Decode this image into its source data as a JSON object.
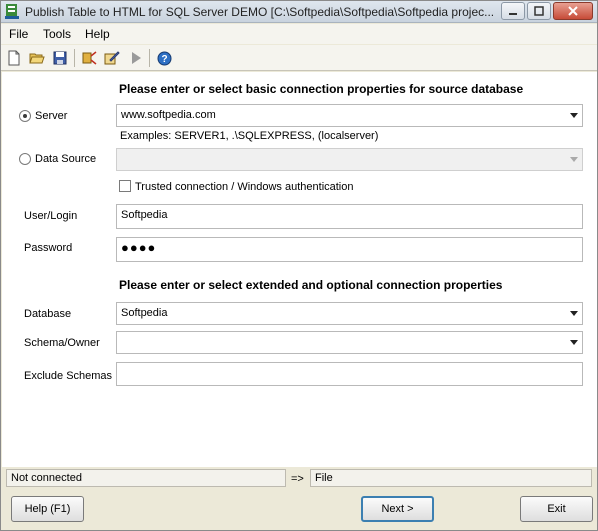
{
  "window": {
    "title": "Publish Table to HTML for SQL Server DEMO [C:\\Softpedia\\Softpedia\\Softpedia projec..."
  },
  "menu": {
    "file": "File",
    "tools": "Tools",
    "help": "Help"
  },
  "toolbar": {
    "icons": [
      "new-icon",
      "open-icon",
      "save-icon",
      "connect-icon",
      "edit-icon",
      "run-icon",
      "help-icon"
    ]
  },
  "source": {
    "heading": "Please enter or select basic connection properties for source database",
    "server_label": "Server",
    "server_value": "www.softpedia.com",
    "server_examples": "Examples: SERVER1, .\\SQLEXPRESS, (localserver)",
    "datasource_label": "Data Source",
    "datasource_value": "",
    "trusted_label": "Trusted connection / Windows authentication",
    "user_label": "User/Login",
    "user_value": "Softpedia",
    "password_label": "Password",
    "password_value": "●●●●"
  },
  "extended": {
    "heading": "Please enter or select extended and optional connection properties",
    "database_label": "Database",
    "database_value": "Softpedia",
    "schema_label": "Schema/Owner",
    "schema_value": "",
    "exclude_label": "Exclude Schemas",
    "exclude_value": ""
  },
  "status": {
    "left": "Not connected",
    "arrow": "=>",
    "right": "File"
  },
  "buttons": {
    "help": "Help (F1)",
    "next": "Next >",
    "exit": "Exit"
  },
  "colors": {
    "window_bg": "#ece9d8",
    "content_bg": "#ffffff",
    "accent_border": "#3c7fb1"
  }
}
